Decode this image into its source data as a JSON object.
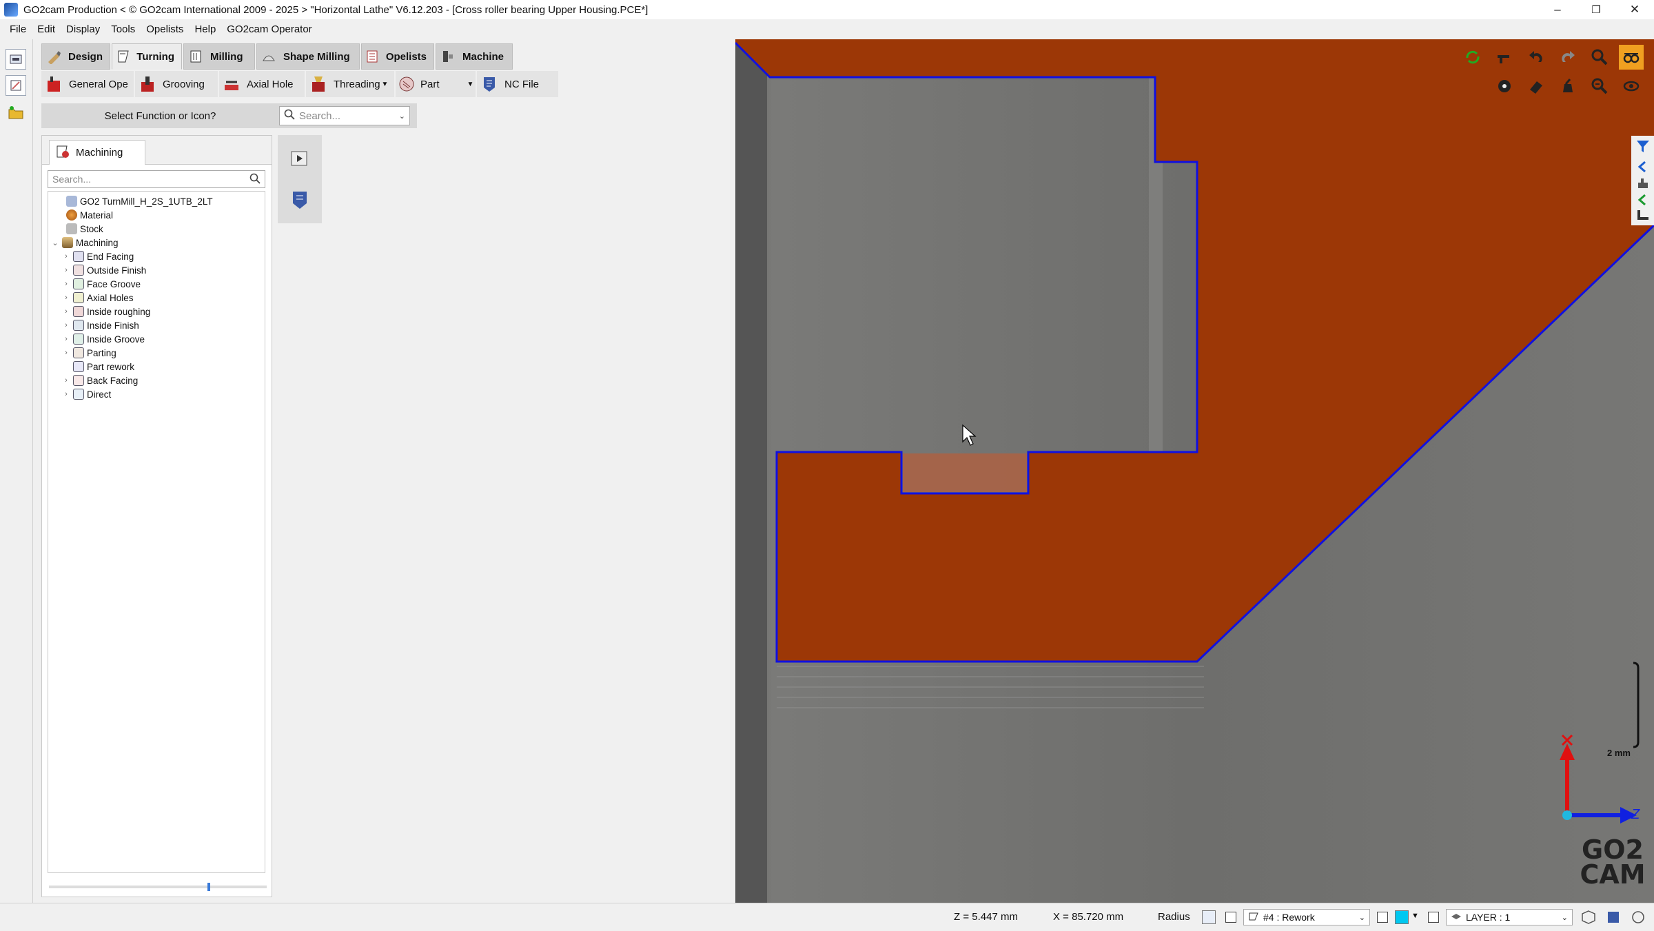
{
  "window": {
    "title": "GO2cam Production < © GO2cam International 2009 - 2025 >    \"Horizontal Lathe\"   V6.12.203 - [Cross roller bearing Upper Housing.PCE*]",
    "minimize": "–",
    "restore": "❐",
    "close": "✕"
  },
  "menu": [
    "File",
    "Edit",
    "Display",
    "Tools",
    "Opelists",
    "Help",
    "GO2cam Operator"
  ],
  "ribbon": {
    "tabs": [
      {
        "label": "Design",
        "icon": "design-icon"
      },
      {
        "label": "Turning",
        "icon": "turning-icon"
      },
      {
        "label": "Milling",
        "icon": "milling-icon"
      },
      {
        "label": "Shape Milling",
        "icon": "shape-milling-icon"
      },
      {
        "label": "Opelists",
        "icon": "opelists-icon"
      },
      {
        "label": "Machine",
        "icon": "machine-icon"
      }
    ],
    "active_tab": "Turning",
    "buttons": [
      {
        "label": "General Ope",
        "icon": "general-ope-icon"
      },
      {
        "label": "Grooving",
        "icon": "grooving-icon"
      },
      {
        "label": "Axial Hole",
        "icon": "axial-hole-icon"
      },
      {
        "label": "Threading",
        "icon": "threading-icon"
      },
      {
        "label": "Part",
        "icon": "part-icon"
      },
      {
        "label": "NC File",
        "icon": "nc-file-icon"
      }
    ]
  },
  "select_bar": {
    "label": "Select Function or Icon?",
    "search_placeholder": "Search..."
  },
  "panel": {
    "tab_label": "Machining",
    "search_placeholder": "Search...",
    "tree": {
      "machine": "GO2 TurnMill_H_2S_1UTB_2LT",
      "material": "Material",
      "stock": "Stock",
      "machining": "Machining",
      "operations": [
        "End Facing",
        "Outside Finish",
        "Face Groove",
        "Axial Holes",
        "Inside roughing",
        "Inside Finish",
        "Inside Groove",
        "Parting",
        "Part rework",
        "Back Facing",
        "Direct"
      ]
    }
  },
  "viewport": {
    "scale_label": "2 mm",
    "axis_x": "X",
    "axis_z": "Z",
    "logo_line1": "GO2",
    "logo_line2": "CAM",
    "part_color": "#a03a05",
    "contour_color": "#1010e0"
  },
  "status": {
    "z": "Z = 5.447 mm",
    "x": "X = 85.720 mm",
    "mode": "Radius",
    "operation": "#4 : Rework",
    "layer": "LAYER : 1",
    "accent": "#00c8f0"
  }
}
